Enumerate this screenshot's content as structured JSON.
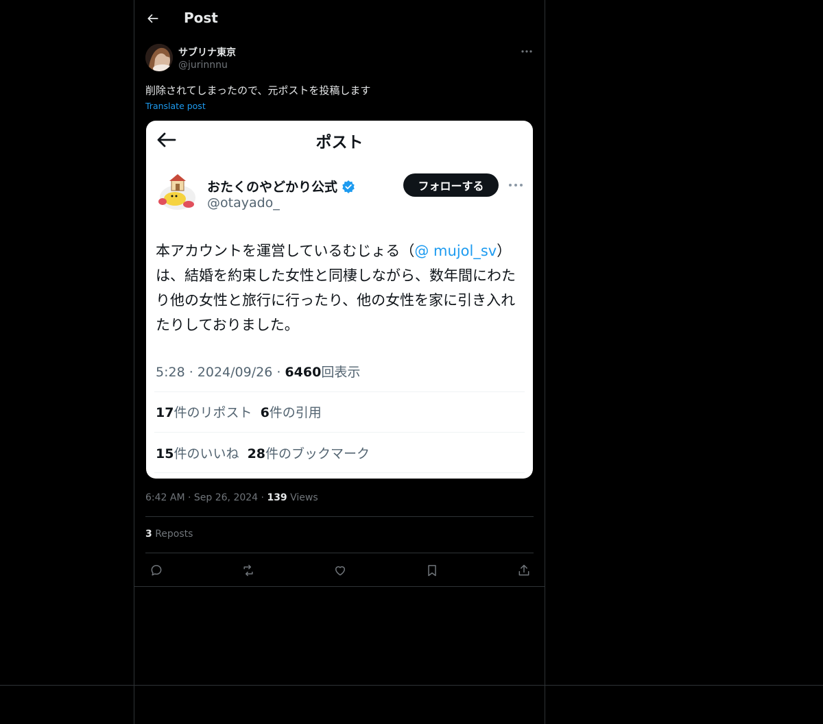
{
  "header": {
    "title": "Post"
  },
  "post": {
    "author_name": "サブリナ東京",
    "author_handle": "@jurinnnu",
    "text": "削除されてしまったので、元ポストを投稿します",
    "translate_label": "Translate post",
    "time": "6:42 AM",
    "date": "Sep 26, 2024",
    "views_count": "139",
    "views_label": "Views",
    "reposts_count": "3",
    "reposts_label": "Reposts"
  },
  "embedded": {
    "title": "ポスト",
    "account_name": "おたくのやどかり公式",
    "account_handle": "@otayado_",
    "follow_label": "フォローする",
    "body_before": "本アカウントを運営しているむじょる（",
    "mention": "@ mujol_sv",
    "body_after": "）は、結婚を約束した女性と同棲しながら、数年間にわたり他の女性と旅行に行ったり、他の女性を家に引き入れたりしておりました。",
    "meta_time": "5:28 · 2024/09/26 · ",
    "views_count": "6460",
    "views_label": "回表示",
    "reposts_count": "17",
    "reposts_label": "件のリポスト",
    "quotes_count": "6",
    "quotes_label": "件の引用",
    "likes_count": "15",
    "likes_label": "件のいいね",
    "bookmarks_count": "28",
    "bookmarks_label": "件のブックマーク"
  },
  "actions": {
    "reply_icon": "reply-icon",
    "repost_icon": "repost-icon",
    "like_icon": "heart-icon",
    "bookmark_icon": "bookmark-icon",
    "share_icon": "share-icon"
  },
  "colors": {
    "background": "#000000",
    "border": "#2f3336",
    "accent": "#1d9bf0",
    "muted": "#71767b",
    "text": "#e7e9ea"
  }
}
